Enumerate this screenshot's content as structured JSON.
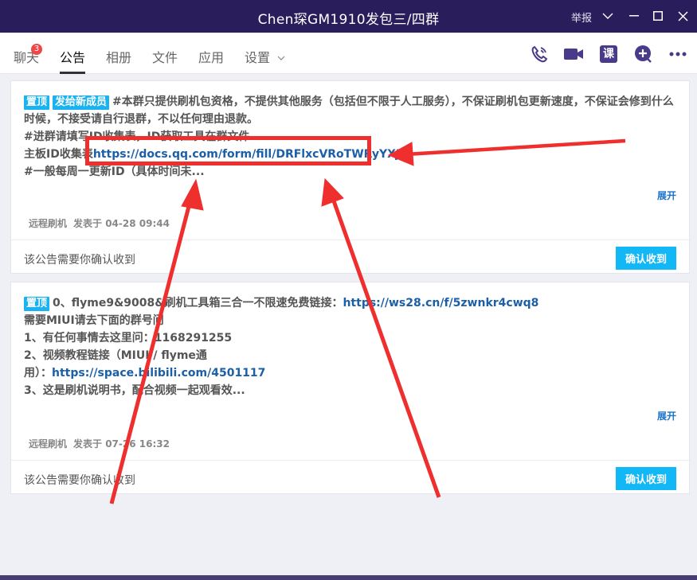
{
  "window": {
    "title": "Chen琛GM1910发包三/四群",
    "report_label": "举报"
  },
  "tabs": [
    {
      "label": "聊天",
      "badge": "3"
    },
    {
      "label": "公告"
    },
    {
      "label": "相册"
    },
    {
      "label": "文件"
    },
    {
      "label": "应用"
    },
    {
      "label": "设置"
    }
  ],
  "toolbar": {
    "course_label": "课"
  },
  "announcements": [
    {
      "tags": [
        "置顶",
        "发给新成员"
      ],
      "line1": "#本群只提供刷机包资格，不提供其他服务（包括但不限于人工服务），不保证刷机包更新速度，不保证会修到什么时候，不接受请自行退群，不以任何理由退款。",
      "line2": "#进群请填写ID收集表，ID获取工具在群文件",
      "line3_prefix": "主板ID收集表",
      "line3_link": "https://docs.qq.com/form/fill/DRFlxcVRoTWRyYXJJ",
      "line4": "#一般每周一更新ID（具体时间未...",
      "expand_label": "展开",
      "author": "远程刷机",
      "posted": "发表于 04-28 09:44",
      "footer_note": "该公告需要你确认收到",
      "confirm_label": "确认收到"
    },
    {
      "tags": [
        "置顶"
      ],
      "line1_prefix": "0、flyme9&9008&刷机工具箱三合一不限速免费链接：",
      "line1_link": "https://ws28.cn/f/5zwnkr4cwq8",
      "line2": "需要MIUI请去下面的群号问",
      "line3": "1、有任何事情去这里问：1168291255",
      "line4": "2、视频教程链接（MIUI / flyme通",
      "line5_prefix": "用）：",
      "line5_link": "https://space.bilibili.com/4501117",
      "line6": "3、这是刷机说明书，配合视频一起观看效...",
      "expand_label": "展开",
      "author": "远程刷机",
      "posted": "发表于 07-26 16:32",
      "footer_note": "该公告需要你确认收到",
      "confirm_label": "确认收到"
    }
  ],
  "colors": {
    "titlebar": "#2a1d5c",
    "tag": "#1ab2f0",
    "confirm": "#12b7f5",
    "annotation": "#ef2e2e"
  }
}
